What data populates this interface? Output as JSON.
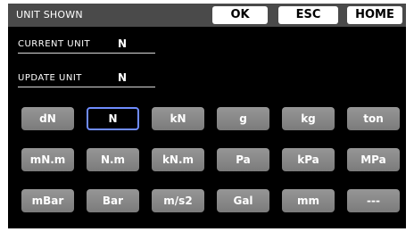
{
  "header": {
    "title": "UNIT SHOWN",
    "ok_label": "OK",
    "esc_label": "ESC",
    "home_label": "HOME"
  },
  "current_unit": {
    "label": "CURRENT UNIT",
    "value": "N"
  },
  "update_unit": {
    "label": "UPDATE UNIT",
    "value": "N"
  },
  "units": {
    "row1": [
      "dN",
      "N",
      "kN",
      "g",
      "kg",
      "ton"
    ],
    "row2": [
      "mN.m",
      "N.m",
      "kN.m",
      "Pa",
      "kPa",
      "MPa"
    ],
    "row3": [
      "mBar",
      "Bar",
      "m/s2",
      "Gal",
      "mm",
      "---"
    ]
  },
  "selected_unit": "N",
  "colors": {
    "screen_bg": "#000000",
    "titlebar_bg": "#4a4a4a",
    "button_gray": "#8a8a8a",
    "selected_border": "#6f8cff"
  }
}
